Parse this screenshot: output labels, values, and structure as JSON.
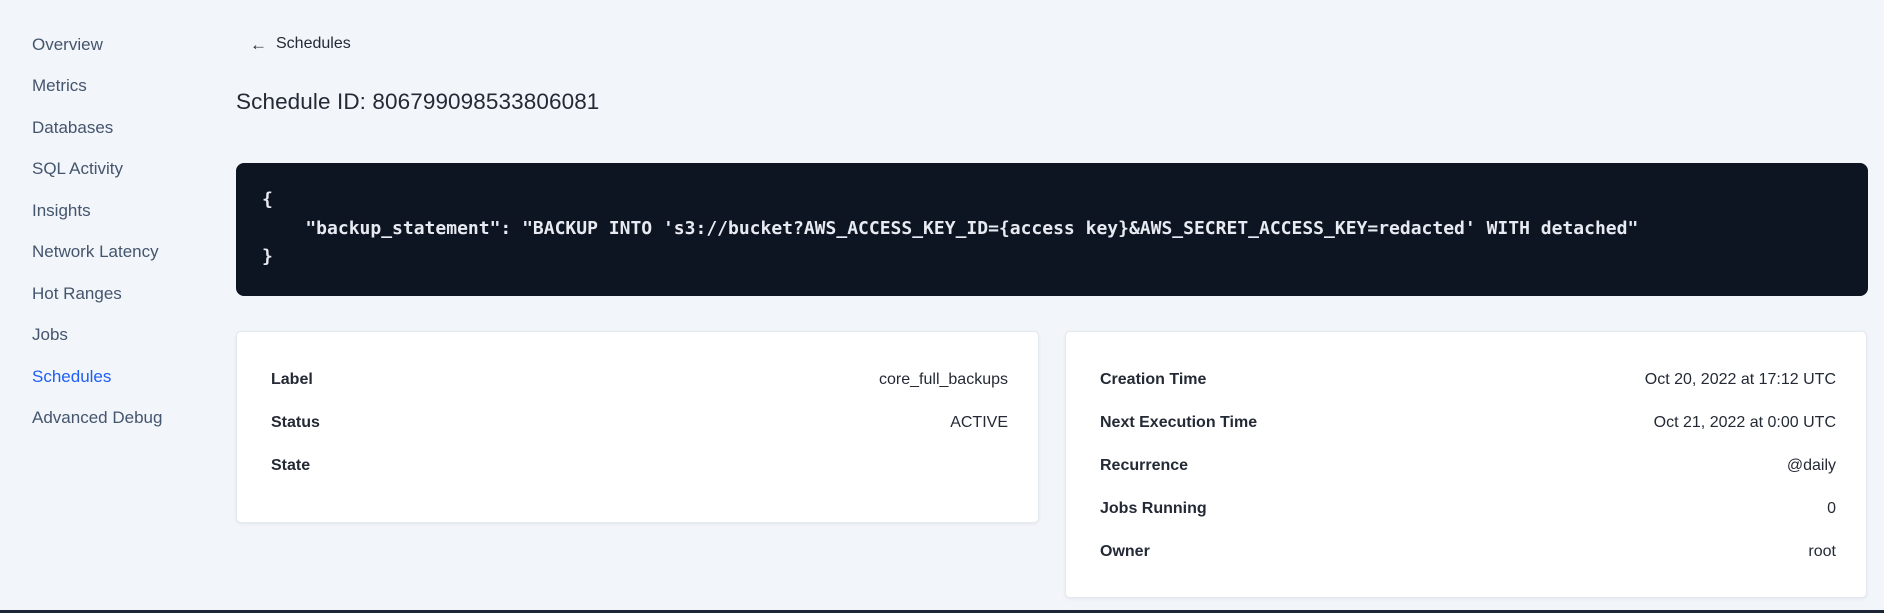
{
  "page": {
    "back_arrow": "←",
    "back_label": "Schedules",
    "title": "Schedule ID: 806799098533806081"
  },
  "sidebar": {
    "items": [
      {
        "label": "Overview",
        "active": false
      },
      {
        "label": "Metrics",
        "active": false
      },
      {
        "label": "Databases",
        "active": false
      },
      {
        "label": "SQL Activity",
        "active": false
      },
      {
        "label": "Insights",
        "active": false
      },
      {
        "label": "Network Latency",
        "active": false
      },
      {
        "label": "Hot Ranges",
        "active": false
      },
      {
        "label": "Jobs",
        "active": false
      },
      {
        "label": "Schedules",
        "active": true
      },
      {
        "label": "Advanced Debug",
        "active": false
      }
    ]
  },
  "code": {
    "lines": [
      "{",
      "    \"backup_statement\": \"BACKUP INTO 's3://bucket?AWS_ACCESS_KEY_ID={access key}&AWS_SECRET_ACCESS_KEY=redacted' WITH detached\"",
      "}"
    ]
  },
  "cards": {
    "schedule": {
      "rows": [
        {
          "label": "Label",
          "value": "core_full_backups"
        },
        {
          "label": "Status",
          "value": "ACTIVE"
        },
        {
          "label": "State",
          "value": ""
        }
      ]
    },
    "timing": {
      "rows": [
        {
          "label": "Creation Time",
          "value": "Oct 20, 2022 at 17:12 UTC"
        },
        {
          "label": "Next Execution Time",
          "value": "Oct 21, 2022 at 0:00 UTC"
        },
        {
          "label": "Recurrence",
          "value": "@daily"
        },
        {
          "label": "Jobs Running",
          "value": "0"
        },
        {
          "label": "Owner",
          "value": "root"
        }
      ]
    }
  },
  "colors": {
    "page_background": "#f2f5f9",
    "accent_blue": "#1f5ef5",
    "text_dark": "#242a35",
    "sidebar_text": "#44556e",
    "code_background": "#0e1522",
    "code_text": "#e7eaf0",
    "card_background": "#ffffff",
    "card_border": "#e3e9f0",
    "bottom_edge": "#1c2533"
  }
}
